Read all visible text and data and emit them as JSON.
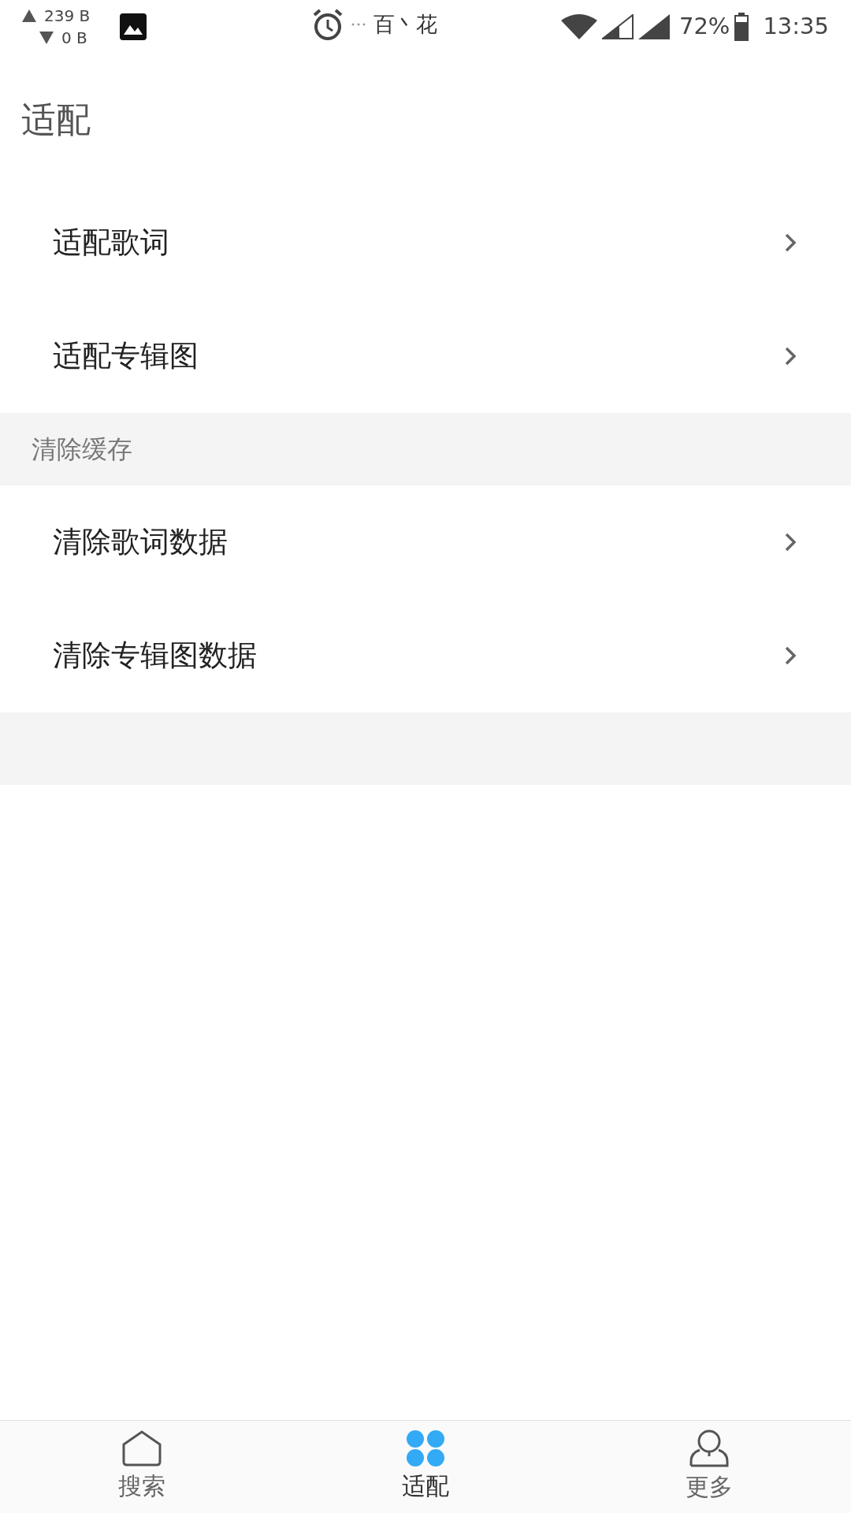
{
  "status_bar": {
    "upload": "239 B",
    "download": "0 B",
    "carrier": "百丶花",
    "battery": "72%",
    "time": "13:35"
  },
  "header": {
    "title": "适配"
  },
  "sections": [
    {
      "items": [
        {
          "label": "适配歌词"
        },
        {
          "label": "适配专辑图"
        }
      ]
    },
    {
      "heading": "清除缓存",
      "items": [
        {
          "label": "清除歌词数据"
        },
        {
          "label": "清除专辑图数据"
        }
      ]
    }
  ],
  "bottom_nav": [
    {
      "kind": "home",
      "label": "搜索",
      "selected": false
    },
    {
      "kind": "grid",
      "label": "适配",
      "selected": true
    },
    {
      "kind": "person",
      "label": "更多",
      "selected": false
    }
  ]
}
